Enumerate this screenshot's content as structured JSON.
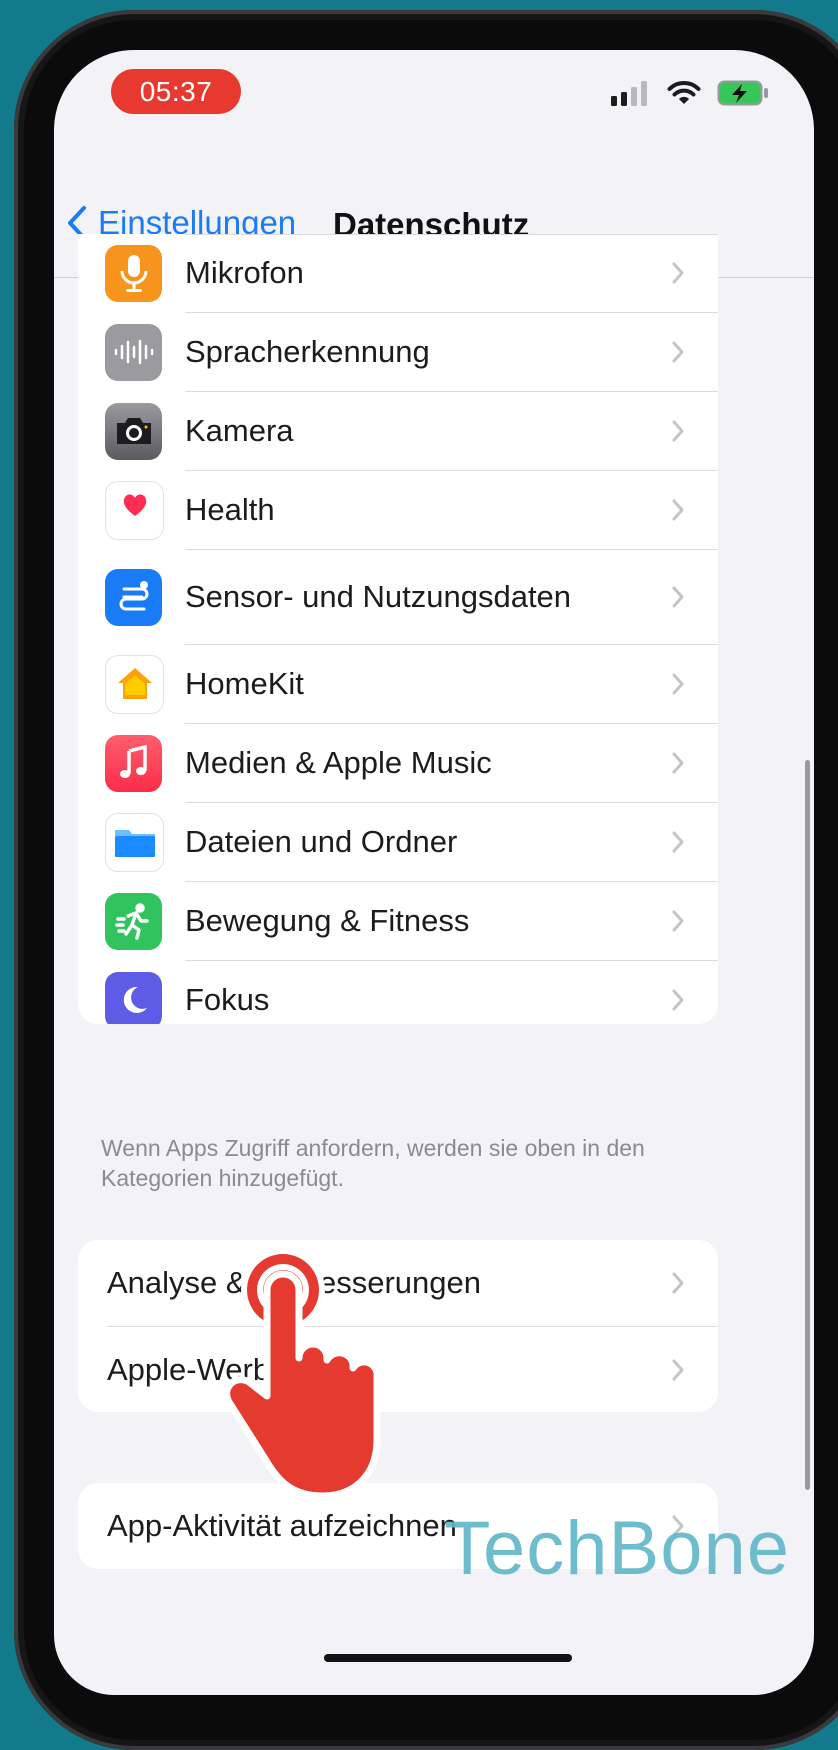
{
  "status_bar": {
    "time": "05:37"
  },
  "nav": {
    "back_label": "Einstellungen",
    "title": "Datenschutz"
  },
  "privacy_items": [
    {
      "label": "Mikrofon",
      "icon": "microphone-icon",
      "color": "#f7941d"
    },
    {
      "label": "Spracherkennung",
      "icon": "waveform-icon",
      "color": "#8e8e93"
    },
    {
      "label": "Kamera",
      "icon": "camera-icon",
      "color": "#6d6d72"
    },
    {
      "label": "Health",
      "icon": "heart-icon",
      "color": "#ff2d55"
    },
    {
      "label": "Sensor- und Nutzungsdaten",
      "icon": "sensor-icon",
      "color": "#1a7cf5"
    },
    {
      "label": "HomeKit",
      "icon": "home-icon",
      "color": "#ff9f0a"
    },
    {
      "label": "Medien & Apple Music",
      "icon": "music-icon",
      "color": "#fa2d48"
    },
    {
      "label": "Dateien und Ordner",
      "icon": "folder-icon",
      "color": "#1a8cff"
    },
    {
      "label": "Bewegung & Fitness",
      "icon": "fitness-icon",
      "color": "#30c35e"
    },
    {
      "label": "Fokus",
      "icon": "moon-icon",
      "color": "#5e5ce6"
    }
  ],
  "footnote": "Wenn Apps Zugriff anfordern, werden sie oben in den Kategorien hinzugefügt.",
  "group2": [
    {
      "label": "Analyse & Verbesserungen"
    },
    {
      "label": "Apple-Werbung"
    }
  ],
  "group3": [
    {
      "label": "App-Aktivität aufzeichnen"
    }
  ],
  "watermark": "TechBone"
}
